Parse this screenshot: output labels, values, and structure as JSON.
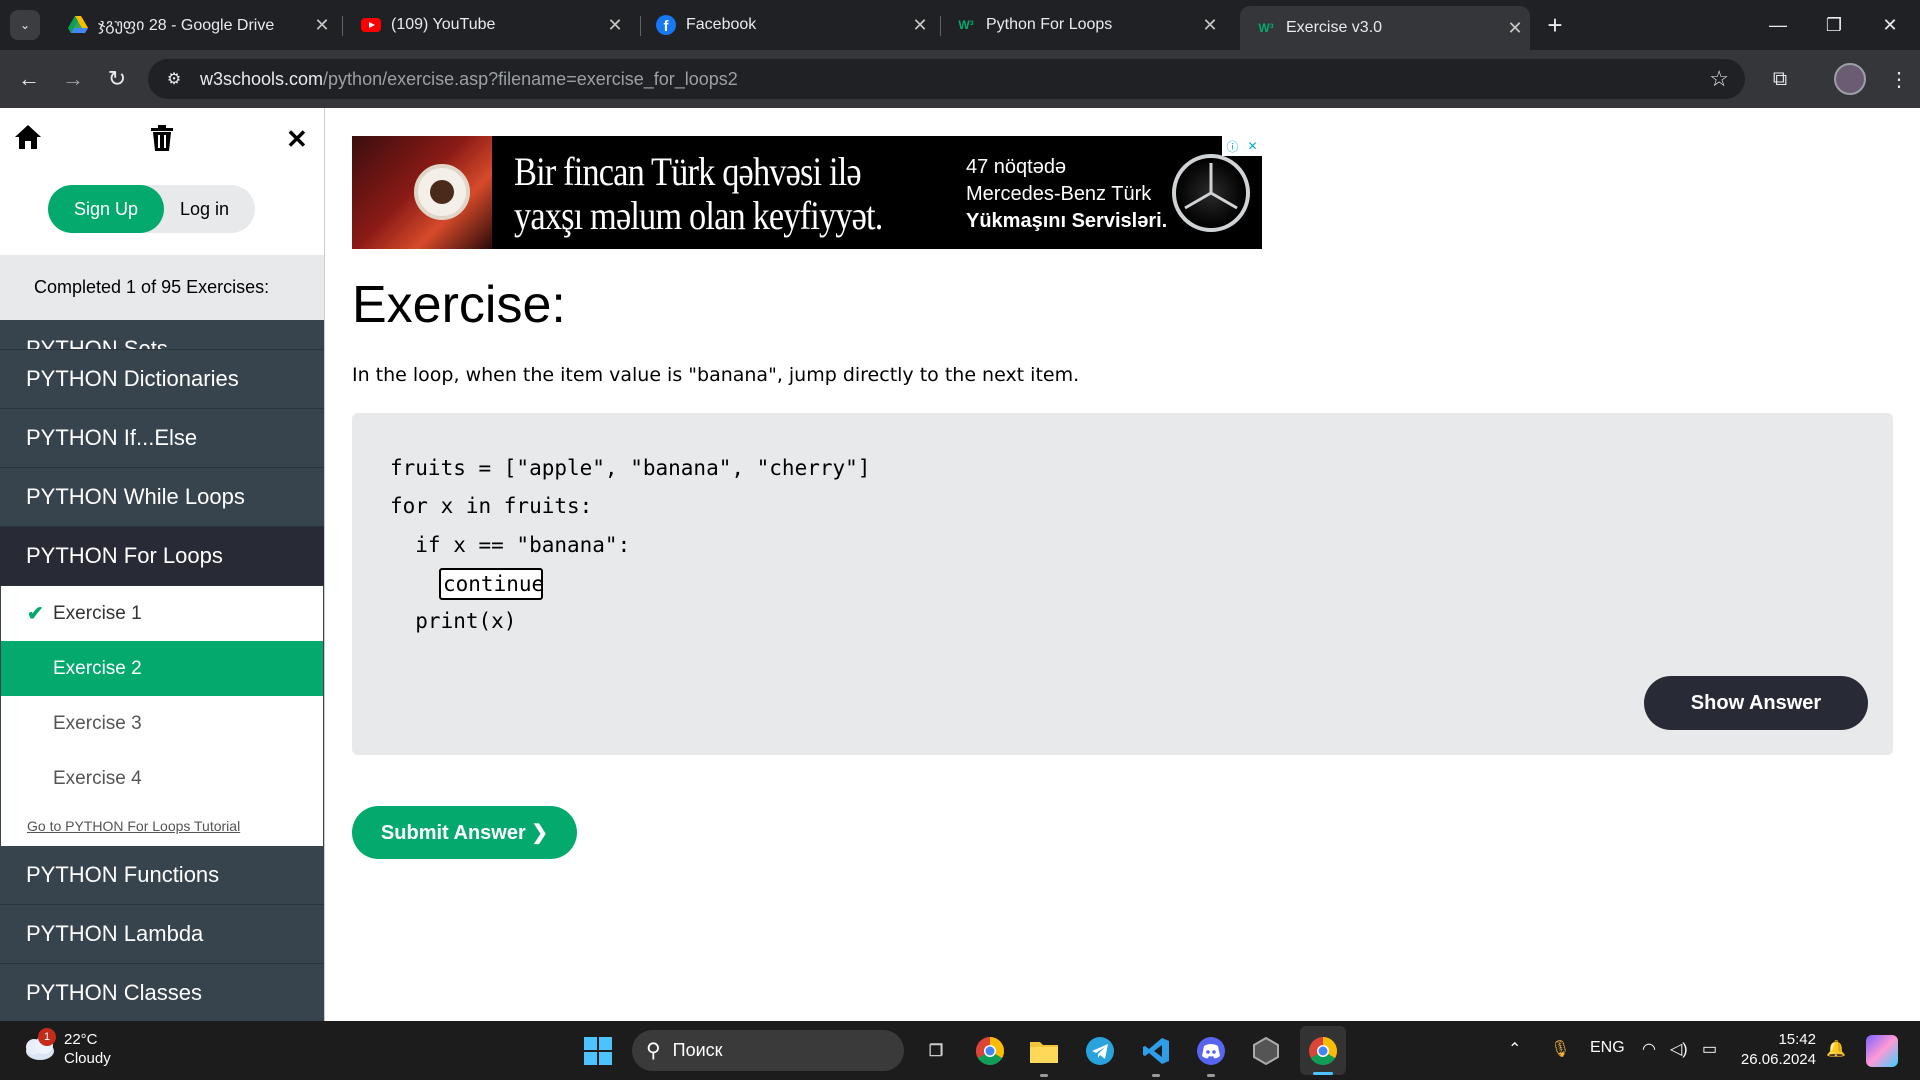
{
  "browser": {
    "tabs": [
      {
        "title": "ჯგუფი 28 - Google Drive",
        "icon": "google-drive-icon"
      },
      {
        "title": "(109) YouTube",
        "icon": "youtube-icon"
      },
      {
        "title": "Facebook",
        "icon": "facebook-icon"
      },
      {
        "title": "Python For Loops",
        "icon": "w3schools-icon"
      },
      {
        "title": "Exercise v3.0",
        "icon": "w3schools-icon",
        "active": true
      }
    ],
    "url_host": "w3schools.com",
    "url_path": "/python/exercise.asp?filename=exercise_for_loops2"
  },
  "sidebar": {
    "signup_label": "Sign Up",
    "login_label": "Log in",
    "progress_text": "Completed 1 of 95 Exercises:",
    "cut_item": "PYTHON Sets",
    "items_before": [
      "PYTHON Dictionaries",
      "PYTHON If...Else",
      "PYTHON While Loops"
    ],
    "current_item": "PYTHON For Loops",
    "exercises": [
      "Exercise 1",
      "Exercise 2",
      "Exercise 3",
      "Exercise 4"
    ],
    "completed_exercise": "Exercise 1",
    "active_exercise": "Exercise 2",
    "tutorial_link": "Go to PYTHON For Loops Tutorial",
    "items_after": [
      "PYTHON Functions",
      "PYTHON Lambda",
      "PYTHON Classes"
    ]
  },
  "ad": {
    "headline_1": "Bir fincan Türk qəhvəsi ilə",
    "headline_2": "yaxşı məlum olan keyfiyyət.",
    "side_1": "47 nöqtədə",
    "side_2": "Mercedes-Benz Türk",
    "side_3": "Yükmaşını Servisləri."
  },
  "exercise": {
    "title": "Exercise:",
    "description": "In the loop, when the item value is \"banana\", jump directly to the next item.",
    "code_lines": [
      "fruits = [\"apple\", \"banana\", \"cherry\"]",
      "for x in fruits:",
      "  if x == \"banana\":",
      "",
      "  print(x)"
    ],
    "answer_value": "continue",
    "show_answer_label": "Show Answer",
    "submit_label": "Submit Answer ❯"
  },
  "taskbar": {
    "weather_temp": "22°C",
    "weather_desc": "Cloudy",
    "weather_badge": "1",
    "search_placeholder": "Поиск",
    "language": "ENG",
    "time": "15:42",
    "date": "26.06.2024"
  }
}
